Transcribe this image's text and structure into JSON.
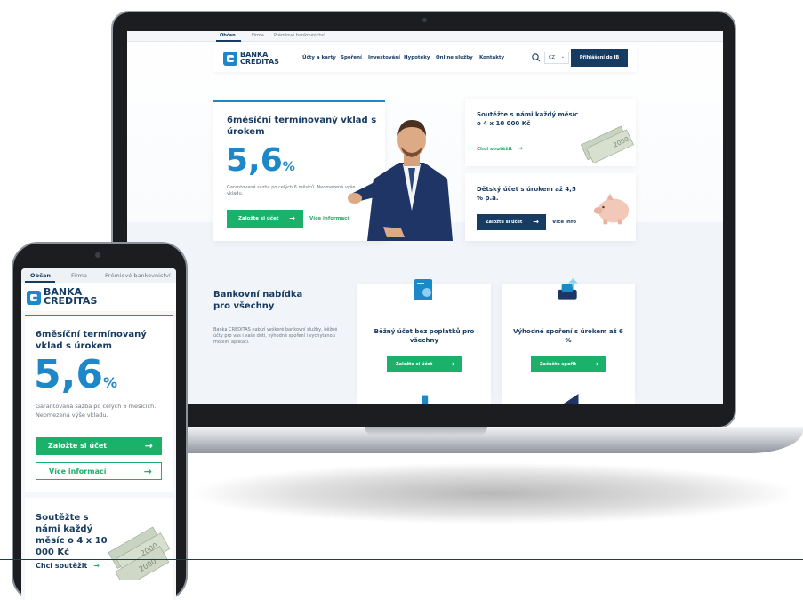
{
  "segments": [
    "Občan",
    "Firma",
    "Prémiové bankovnictví"
  ],
  "logo": {
    "line1": "BANKA",
    "line2": "CREDITAS"
  },
  "nav": {
    "items": [
      "Účty a karty",
      "Spoření",
      "Investování",
      "Hypotéky",
      "Online služby",
      "Kontakty"
    ],
    "lang": "CZ",
    "login": "Přihlášení do IB"
  },
  "hero": {
    "title": "6měsíční termínovaný vklad s úrokem",
    "rate_value": "5,6",
    "rate_unit": "%",
    "desc": "Garantovaná sazba po celých 6 měsíců. Neomezená výše vkladu.",
    "primary_button": "Založte si účet",
    "secondary_link": "Více informací"
  },
  "promo_contest": {
    "title": "Soutěžte s námi každý měsíc o 4 x 10 000 Kč",
    "link": "Chci soutěžit"
  },
  "promo_child": {
    "title": "Dětský účet s úrokem až 4,5 % p.a.",
    "button": "Založte si účet",
    "link": "Více info"
  },
  "offer": {
    "title": "Bankovní nabídka pro všechny",
    "desc": "Banka CREDITAS nabízí veškeré bankovní služby, běžné účty pro vás i vaše děti, výhodné spoření i vychytanou mobilní aplikaci.",
    "products": [
      {
        "title": "Běžný účet bez poplatků pro všechny",
        "button": "Založte si účet"
      },
      {
        "title": "Výhodné spoření s úrokem až 6 %",
        "button": "Začněte spořit"
      }
    ]
  },
  "mobile": {
    "hero_title": "6měsíční termínovaný vklad s úrokem",
    "rate_value": "5,6",
    "rate_unit": "%",
    "desc": "Garantovaná sazba po celých 6 měsících. Neomezená výše vkladu.",
    "primary_button": "Založte si účet",
    "secondary_button": "Více informací",
    "contest_title": "Soutěžte s námi každý měsíc o 4 x 10 000 Kč",
    "contest_link": "Chci soutěžit"
  },
  "colors": {
    "navy": "#173c63",
    "brand_blue": "#1e87c7",
    "green": "#1ab26b"
  },
  "icons": [
    "search-icon",
    "chevron-down-icon",
    "arrow-right-icon",
    "card-icon",
    "coins-icon",
    "piggy-bank-icon",
    "banknotes-icon"
  ]
}
